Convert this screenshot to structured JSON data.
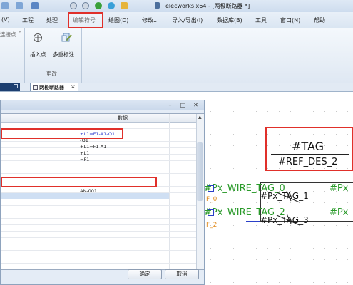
{
  "app": {
    "title": "elecworks x64 - [两极断路器 *]"
  },
  "menubar": {
    "items": [
      {
        "label": "(V)"
      },
      {
        "label": "工程"
      },
      {
        "label": "处理"
      },
      {
        "label": "编辑符号"
      },
      {
        "label": "绘图(D)"
      },
      {
        "label": "修改..."
      },
      {
        "label": "导入/导出(I)"
      },
      {
        "label": "数据库(B)"
      },
      {
        "label": "工具"
      },
      {
        "label": "窗口(N)"
      },
      {
        "label": "帮助"
      }
    ]
  },
  "ribbon": {
    "left_group_label": "连接点",
    "insert_point_label": "插入点",
    "multi_mark_label": "多重标注",
    "group_label": "更改"
  },
  "tabs": {
    "doc_tab_label": "两极断路器",
    "close_glyph": "×"
  },
  "dialog": {
    "column_header": "数据",
    "rows": [
      {
        "value": "+L1=F1-A1-Q1",
        "color": "#2f3fd0"
      },
      {
        "value": "-Q1",
        "color": "#222222"
      },
      {
        "value": "+L1=F1-A1",
        "color": "#222222"
      },
      {
        "value": "+L1",
        "color": "#222222"
      },
      {
        "value": "=F1",
        "color": "#222222"
      },
      {
        "value": "",
        "color": "#222222"
      },
      {
        "value": "",
        "color": "#222222"
      },
      {
        "value": "",
        "color": "#222222"
      },
      {
        "value": "",
        "color": "#222222"
      },
      {
        "value": "AN-001",
        "color": "#222222"
      }
    ],
    "ok_label": "确定",
    "cancel_label": "取消"
  },
  "schematic": {
    "tag": "#TAG",
    "ref_des": "#REF_DES_2",
    "wire_tag_0": "#Px_WIRE_TAG_0",
    "wire_tag_2": "#Px_WIRE_TAG_2",
    "f0": "F_0",
    "f2": "F_2",
    "px_top": "#Px",
    "px_tag_1": "#Px_TAG_1",
    "px_tag_3": "#Px_TAG_3",
    "px_partial": "#Px",
    "red_box_color": "#e0302a",
    "wire_color": "#2a9a2a",
    "blue_color": "#2a3fc8",
    "orange_color": "#e08a1c"
  }
}
